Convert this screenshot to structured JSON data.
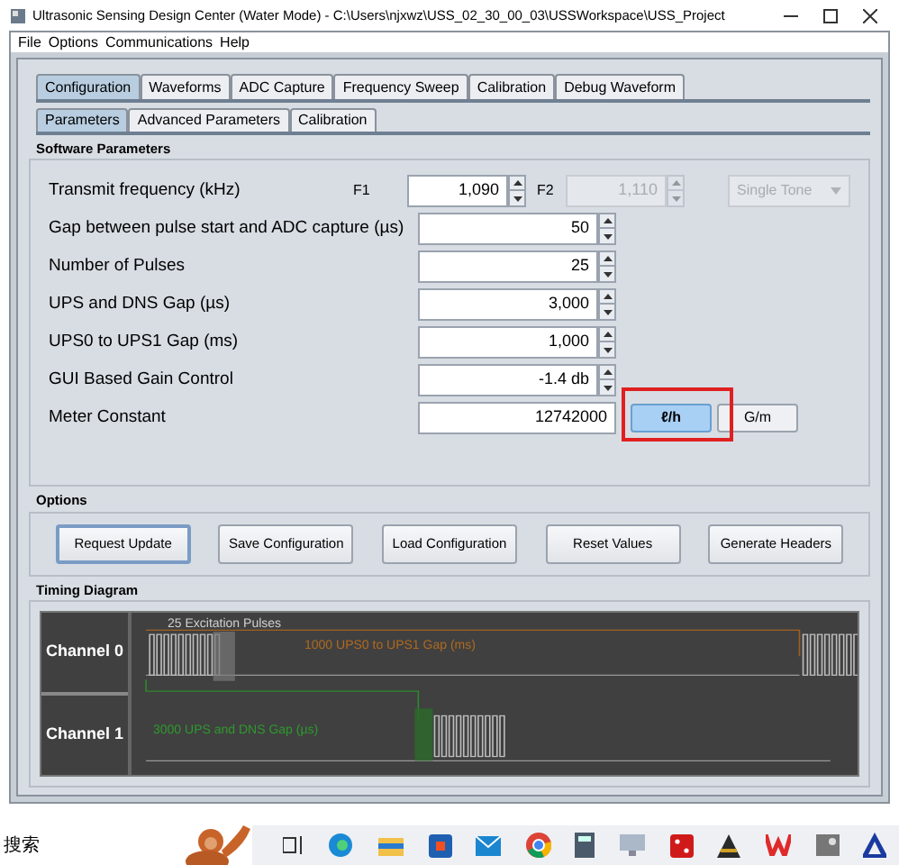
{
  "window": {
    "title": "Ultrasonic Sensing Design Center (Water Mode) - C:\\Users\\njxwz\\USS_02_30_00_03\\USSWorkspace\\USS_Project"
  },
  "menu": [
    "File",
    "Options",
    "Communications",
    "Help"
  ],
  "tabs": [
    {
      "label": "Configuration",
      "selected": true
    },
    {
      "label": "Waveforms",
      "selected": false
    },
    {
      "label": "ADC Capture",
      "selected": false
    },
    {
      "label": "Frequency Sweep",
      "selected": false
    },
    {
      "label": "Calibration",
      "selected": false
    },
    {
      "label": "Debug Waveform",
      "selected": false
    }
  ],
  "subtabs": [
    {
      "label": "Parameters",
      "selected": true
    },
    {
      "label": "Advanced Parameters",
      "selected": false
    },
    {
      "label": "Calibration",
      "selected": false
    }
  ],
  "software_parameters": {
    "title": "Software Parameters",
    "rows": [
      {
        "kind": "dual",
        "label": "Transmit frequency (kHz)",
        "f1_label": "F1",
        "f1_value": "1,090",
        "f2_label": "F2",
        "f2_value": "1,110",
        "f2_disabled": true,
        "mode": "Single Tone",
        "mode_disabled": true
      },
      {
        "kind": "spin",
        "label": "Gap between pulse start and ADC capture (µs)",
        "value": "50"
      },
      {
        "kind": "spin",
        "label": "Number of Pulses",
        "value": "25"
      },
      {
        "kind": "spin",
        "label": "UPS and DNS Gap (µs)",
        "value": "3,000"
      },
      {
        "kind": "spin",
        "label": "UPS0 to UPS1 Gap (ms)",
        "value": "1,000"
      },
      {
        "kind": "spin",
        "label": "GUI Based Gain Control",
        "value": "-1.4 db"
      },
      {
        "kind": "units",
        "label": "Meter Constant",
        "value": "12742000",
        "units": [
          {
            "label": "ℓ/h",
            "selected": true
          },
          {
            "label": "G/m",
            "selected": false
          }
        ]
      }
    ]
  },
  "options": {
    "title": "Options",
    "buttons": [
      {
        "label": "Request Update",
        "focused": true
      },
      {
        "label": "Save Configuration",
        "focused": false
      },
      {
        "label": "Load Configuration",
        "focused": false
      },
      {
        "label": "Reset Values",
        "focused": false
      },
      {
        "label": "Generate Headers",
        "focused": false
      }
    ]
  },
  "timing": {
    "title": "Timing Diagram",
    "channels": [
      "Channel 0",
      "Channel 1"
    ],
    "pulses_label": "25 Excitation Pulses",
    "ups_gap_label": "1000 UPS0 to UPS1 Gap (ms)",
    "dns_gap_label": "3000 UPS and DNS Gap (µs)"
  },
  "taskbar": {
    "search": "搜索"
  }
}
